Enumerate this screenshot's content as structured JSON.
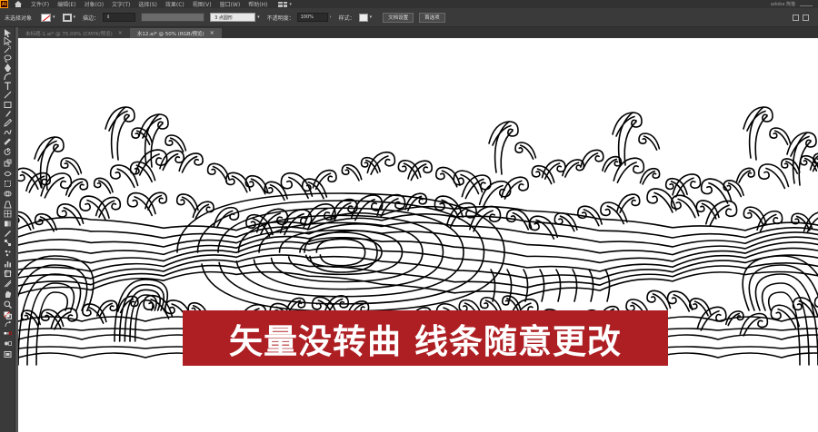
{
  "menubar": {
    "logo": "Ai",
    "items": [
      "文件(F)",
      "编辑(E)",
      "对象(O)",
      "文字(T)",
      "选择(S)",
      "效果(C)",
      "视图(V)",
      "窗口(W)",
      "帮助(H)"
    ],
    "user": "adobe 熊猫"
  },
  "controlbar": {
    "selection_status": "未选择对象",
    "stroke_label": "描边：",
    "brush_value": "3 点圆形",
    "opacity_label": "不透明度：",
    "opacity_value": "100%",
    "style_label": "样式：",
    "doc_setup_button": "文档设置",
    "preferences_button": "首选项"
  },
  "tabs": [
    {
      "label": "未标题-1.ai* @ 75.09% (CMYK/预览)",
      "active": false
    },
    {
      "label": "水12.ai* @ 50% (RGB/预览)",
      "active": true
    }
  ],
  "tool_icons": [
    "selection-tool-icon",
    "direct-selection-tool-icon",
    "magic-wand-icon",
    "lasso-icon",
    "pen-tool-icon",
    "curvature-icon",
    "type-tool-icon",
    "line-tool-icon",
    "rectangle-tool-icon",
    "paintbrush-icon",
    "pencil-icon",
    "shaper-icon",
    "eraser-icon",
    "rotate-tool-icon",
    "scale-tool-icon",
    "width-tool-icon",
    "free-transform-icon",
    "shape-builder-icon",
    "perspective-icon",
    "mesh-icon",
    "gradient-icon",
    "eyedropper-icon",
    "blend-icon",
    "symbol-sprayer-icon",
    "graph-icon",
    "artboard-tool-icon",
    "slice-icon",
    "hand-tool-icon",
    "zoom-tool-icon",
    "fill-stroke-icon",
    "swap-colors-icon",
    "color-mode-icon",
    "draw-mode-icon",
    "screen-mode-icon"
  ],
  "colors": {
    "banner": "#ad1f23",
    "artboard": "#ffffff",
    "stroke_swatch": "#d40000"
  },
  "banner": {
    "text": "矢量没转曲 线条随意更改"
  }
}
